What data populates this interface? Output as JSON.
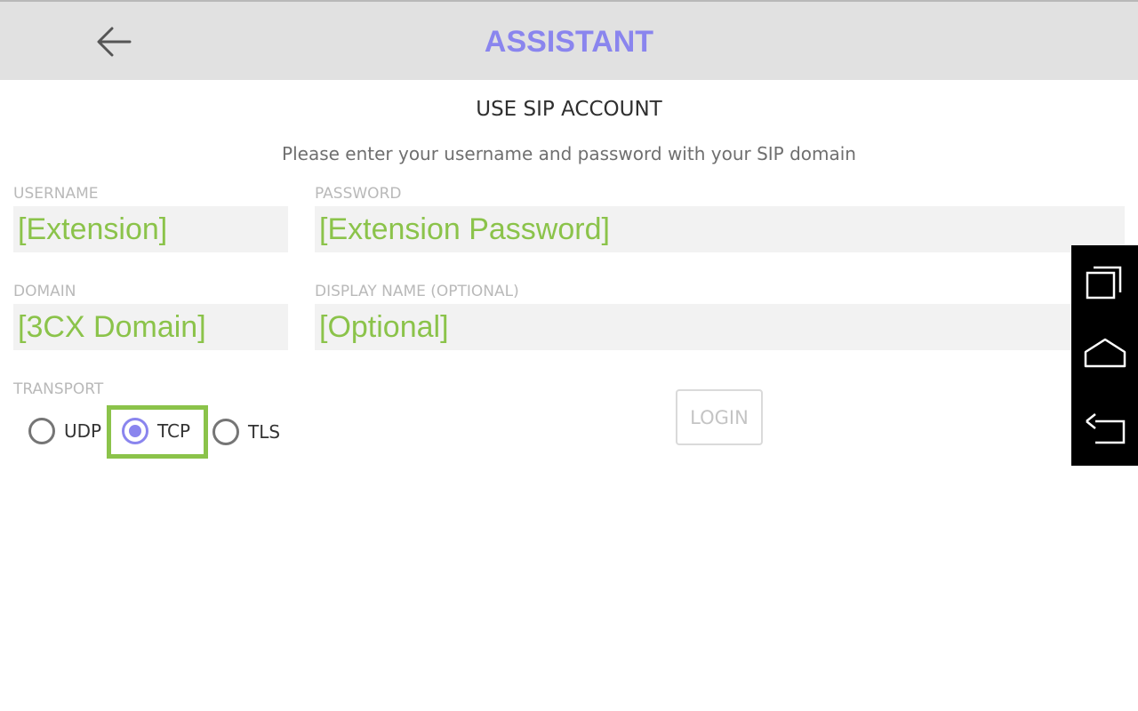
{
  "header": {
    "title": "ASSISTANT",
    "back_icon": "arrow-left-icon"
  },
  "page": {
    "section_title": "USE SIP ACCOUNT",
    "instructions": "Please enter your username and password with your SIP domain"
  },
  "form": {
    "username": {
      "label": "USERNAME",
      "placeholder": "[Extension]",
      "value": ""
    },
    "password": {
      "label": "PASSWORD",
      "placeholder": "[Extension Password]",
      "value": ""
    },
    "domain": {
      "label": "DOMAIN",
      "placeholder": "[3CX Domain]",
      "value": ""
    },
    "display_name": {
      "label": "DISPLAY NAME (OPTIONAL)",
      "placeholder": "[Optional]",
      "value": ""
    },
    "transport": {
      "label": "TRANSPORT",
      "options": [
        {
          "label": "UDP",
          "selected": false
        },
        {
          "label": "TCP",
          "selected": true
        },
        {
          "label": "TLS",
          "selected": false
        }
      ]
    },
    "login_label": "LOGIN"
  },
  "system_nav": {
    "icons": [
      "recent-apps-icon",
      "home-icon",
      "back-icon"
    ]
  },
  "colors": {
    "accent": "#8a85ee",
    "highlight": "#8bc34a",
    "header_bg": "#e1e1e1",
    "field_bg": "#f2f2f2"
  }
}
